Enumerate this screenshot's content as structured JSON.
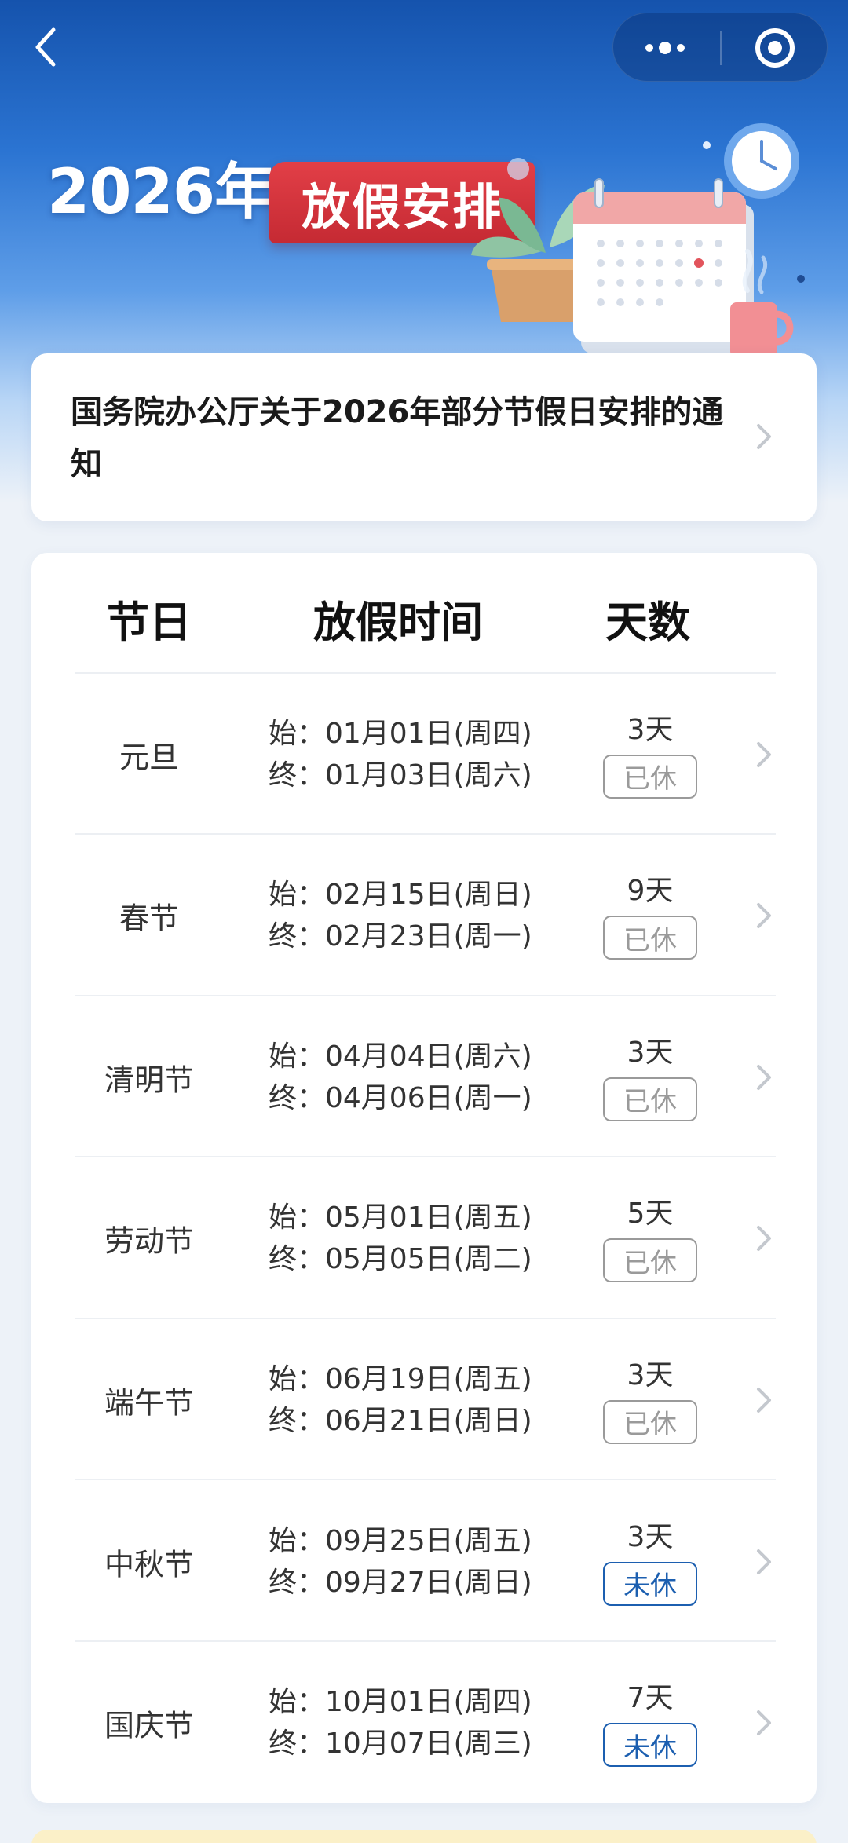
{
  "header": {
    "back_icon": "chevron-left-icon",
    "more_icon": "more-dots-icon",
    "close_icon": "target-circle-icon"
  },
  "banner": {
    "year_text": "2026年",
    "badge_text": "放假安排",
    "colors": {
      "badge": "#d8343d",
      "sky_top": "#1553ad"
    }
  },
  "notice": {
    "title": "国务院办公厅关于2026年部分节假日安排的通知",
    "chevron_icon": "chevron-right-icon"
  },
  "table": {
    "headers": {
      "holiday": "节日",
      "period": "放假时间",
      "days": "天数"
    },
    "rows": [
      {
        "name": "元旦",
        "start": "始：01月01日(周四)",
        "end": "终：01月03日(周六)",
        "days": "3天",
        "status": "已休"
      },
      {
        "name": "春节",
        "start": "始：02月15日(周日)",
        "end": "终：02月23日(周一)",
        "days": "9天",
        "status": "已休"
      },
      {
        "name": "清明节",
        "start": "始：04月04日(周六)",
        "end": "终：04月06日(周一)",
        "days": "3天",
        "status": "已休"
      },
      {
        "name": "劳动节",
        "start": "始：05月01日(周五)",
        "end": "终：05月05日(周二)",
        "days": "5天",
        "status": "已休"
      },
      {
        "name": "端午节",
        "start": "始：06月19日(周五)",
        "end": "终：06月21日(周日)",
        "days": "3天",
        "status": "已休"
      },
      {
        "name": "中秋节",
        "start": "始：09月25日(周五)",
        "end": "终：09月27日(周日)",
        "days": "3天",
        "status": "未休"
      },
      {
        "name": "国庆节",
        "start": "始：10月01日(周四)",
        "end": "终：10月07日(周三)",
        "days": "7天",
        "status": "未休"
      }
    ],
    "status_colors": {
      "已休": "#9a9a9a",
      "未休": "#1c5fb0"
    }
  }
}
